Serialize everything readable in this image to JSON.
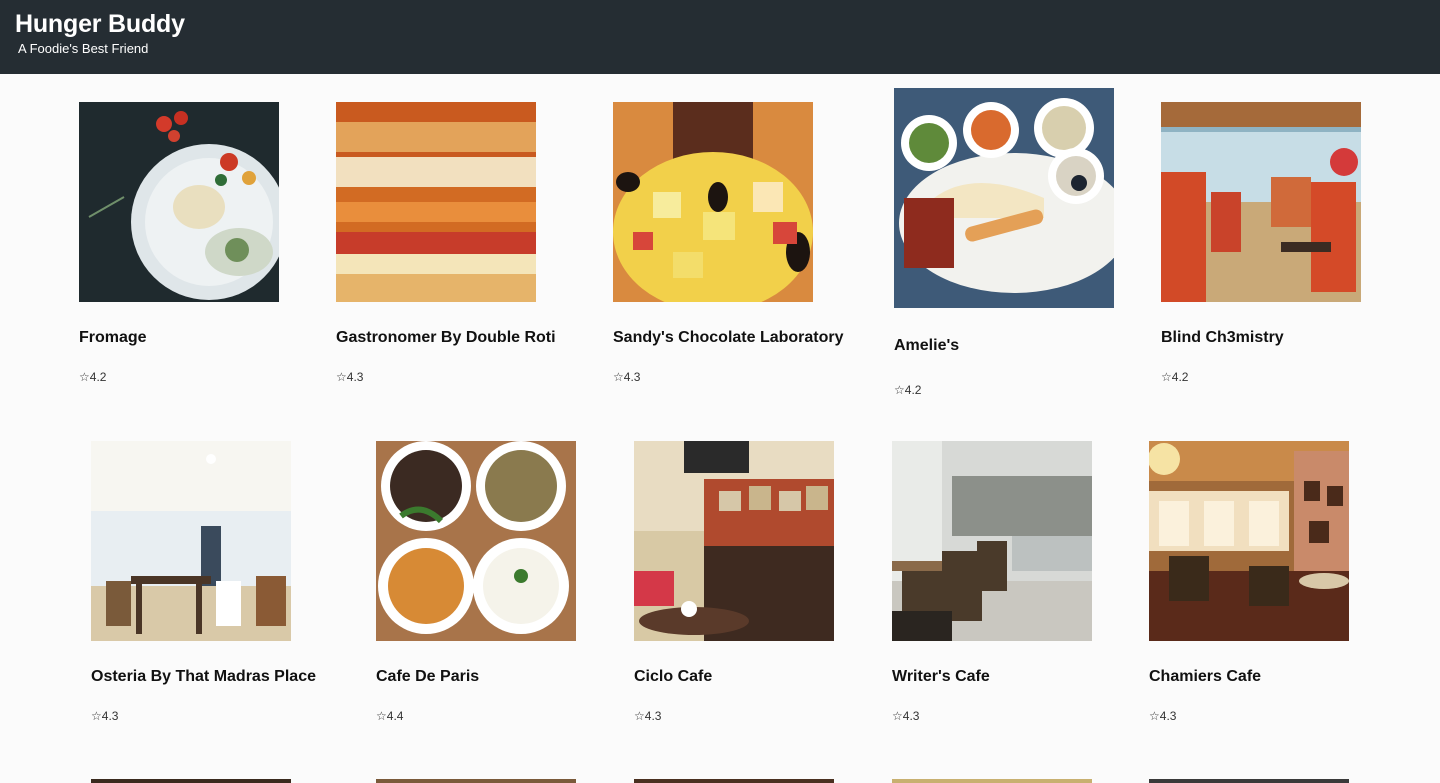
{
  "header": {
    "title": "Hunger Buddy",
    "tagline": "A Foodie's Best Friend"
  },
  "star_icon": "☆",
  "restaurants": [
    {
      "name": "Fromage",
      "rating": "4.2",
      "photo": "pasta-plate"
    },
    {
      "name": "Gastronomer By Double Roti",
      "rating": "4.3",
      "photo": "sandwich"
    },
    {
      "name": "Sandy's Chocolate Laboratory",
      "rating": "4.3",
      "photo": "fruit-salad"
    },
    {
      "name": "Amelie's",
      "rating": "4.2",
      "photo": "mezze-platter"
    },
    {
      "name": "Blind Ch3mistry",
      "rating": "4.2",
      "photo": "interior-red"
    },
    {
      "name": "Osteria By That Madras Place",
      "rating": "4.3",
      "photo": "interior-bright"
    },
    {
      "name": "Cafe De Paris",
      "rating": "4.4",
      "photo": "curry-bowls"
    },
    {
      "name": "Ciclo Cafe",
      "rating": "4.3",
      "photo": "interior-brick"
    },
    {
      "name": "Writer's Cafe",
      "rating": "4.3",
      "photo": "interior-grey"
    },
    {
      "name": "Chamiers Cafe",
      "rating": "4.3",
      "photo": "interior-warm"
    }
  ],
  "colors": {
    "header_bg": "#252d33",
    "page_bg": "#fbfbfb"
  }
}
